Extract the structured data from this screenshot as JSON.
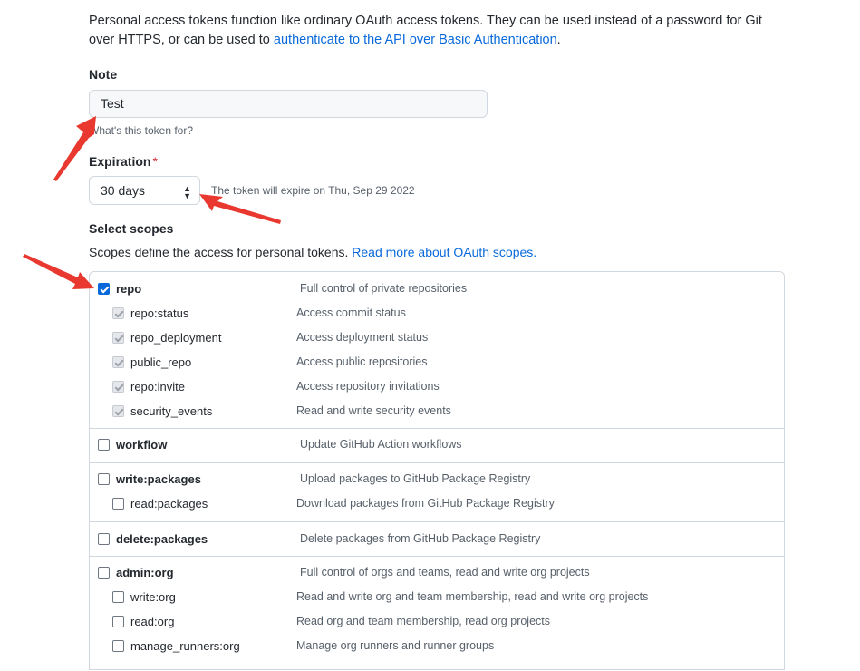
{
  "intro": {
    "text": "Personal access tokens function like ordinary OAuth access tokens. They can be used instead of a password for Git over HTTPS, or can be used to ",
    "link": "authenticate to the API over Basic Authentication",
    "end": "."
  },
  "note": {
    "label": "Note",
    "value": "Test",
    "hint": "What's this token for?"
  },
  "expiration": {
    "label": "Expiration",
    "required_mark": "*",
    "selected": "30 days",
    "info": "The token will expire on Thu, Sep 29 2022"
  },
  "scopes": {
    "title": "Select scopes",
    "description": "Scopes define the access for personal tokens. ",
    "link": "Read more about OAuth scopes.",
    "groups": [
      {
        "name": "repo",
        "desc": "Full control of private repositories",
        "checked": true,
        "children": [
          {
            "name": "repo:status",
            "desc": "Access commit status"
          },
          {
            "name": "repo_deployment",
            "desc": "Access deployment status"
          },
          {
            "name": "public_repo",
            "desc": "Access public repositories"
          },
          {
            "name": "repo:invite",
            "desc": "Access repository invitations"
          },
          {
            "name": "security_events",
            "desc": "Read and write security events"
          }
        ]
      },
      {
        "name": "workflow",
        "desc": "Update GitHub Action workflows",
        "checked": false,
        "children": []
      },
      {
        "name": "write:packages",
        "desc": "Upload packages to GitHub Package Registry",
        "checked": false,
        "children": [
          {
            "name": "read:packages",
            "desc": "Download packages from GitHub Package Registry"
          }
        ]
      },
      {
        "name": "delete:packages",
        "desc": "Delete packages from GitHub Package Registry",
        "checked": false,
        "children": []
      },
      {
        "name": "admin:org",
        "desc": "Full control of orgs and teams, read and write org projects",
        "checked": false,
        "children": [
          {
            "name": "write:org",
            "desc": "Read and write org and team membership, read and write org projects"
          },
          {
            "name": "read:org",
            "desc": "Read org and team membership, read org projects"
          },
          {
            "name": "manage_runners:org",
            "desc": "Manage org runners and runner groups"
          }
        ]
      }
    ]
  },
  "colors": {
    "link": "#0969da",
    "annotation_arrow": "#e8382f",
    "required": "#cf222e"
  }
}
